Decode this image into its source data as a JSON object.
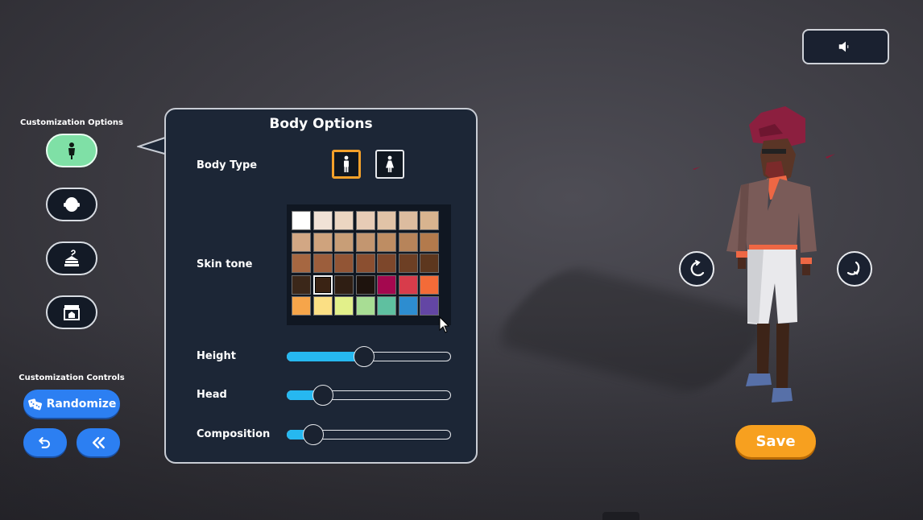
{
  "sidebar": {
    "options_heading": "Customization Options",
    "options": [
      {
        "name": "body",
        "icon": "body-icon",
        "active": true
      },
      {
        "name": "head",
        "icon": "head-icon",
        "active": false
      },
      {
        "name": "outfit",
        "icon": "outfit-icon",
        "active": false
      },
      {
        "name": "shop",
        "icon": "store-icon",
        "active": false
      }
    ],
    "controls_heading": "Customization Controls",
    "randomize_label": "Randomize",
    "undo_icon": "undo-icon",
    "back_icon": "double-chevron-left-icon"
  },
  "panel": {
    "title": "Body Options",
    "body_type_label": "Body Type",
    "body_types": [
      {
        "icon": "male-figure-icon",
        "selected": true
      },
      {
        "icon": "female-figure-icon",
        "selected": false
      }
    ],
    "skin_tone_label": "Skin tone",
    "skin_tones": [
      "#ffffff",
      "#f1e2d6",
      "#ecd6c2",
      "#e7ccb6",
      "#e1c3a7",
      "#dcbc9f",
      "#d8b48f",
      "#d2a784",
      "#cfa37d",
      "#c89e77",
      "#c39670",
      "#be8d63",
      "#b7845a",
      "#b37a4c",
      "#a66741",
      "#9c5e3c",
      "#925535",
      "#8b4f30",
      "#7d472b",
      "#6d3f24",
      "#5d371e",
      "#3b2719",
      "#3a2314",
      "#2f1e13",
      "#1e130d",
      "#a4084f",
      "#d83c4b",
      "#f36b38",
      "#f6a54a",
      "#fbdf84",
      "#e2f08a",
      "#a8dd94",
      "#5fc0a0",
      "#2d8dd0",
      "#6346a4"
    ],
    "selected_skin_index": 22,
    "sliders": [
      {
        "label": "Height",
        "value": 0.47
      },
      {
        "label": "Head",
        "value": 0.22
      },
      {
        "label": "Composition",
        "value": 0.16
      }
    ]
  },
  "viewport": {
    "sound_icon": "speaker-icon",
    "rotate_left_icon": "rotate-left-icon",
    "rotate_right_icon": "rotate-right-icon",
    "save_label": "Save"
  },
  "colors": {
    "active_option": "#7fe0a6",
    "accent_blue": "#2c7ff2",
    "slider_fill": "#26b8f0",
    "save_orange": "#f7a01f",
    "panel_bg": "#1c2636",
    "selected_outline": "#f4a12a"
  }
}
